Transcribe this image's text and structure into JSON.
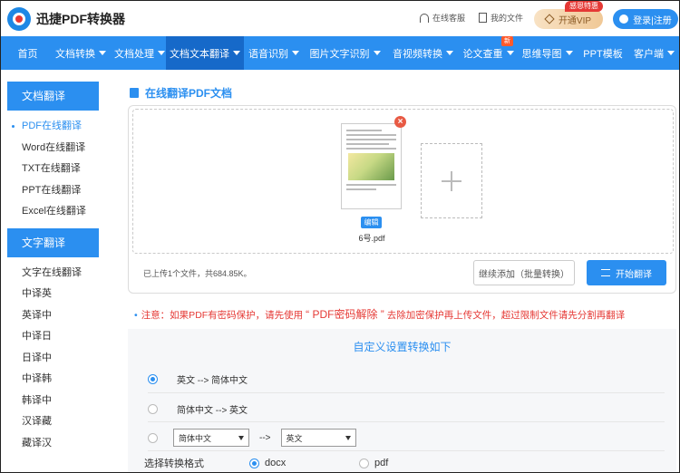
{
  "header": {
    "logo_text": "迅捷PDF转换器",
    "support_label": "在线客服",
    "my_files_label": "我的文件",
    "vip_label": "开通VIP",
    "vip_badge": "感恩特惠",
    "login_label": "登录|注册"
  },
  "nav": [
    {
      "label": "首页",
      "dropdown": false
    },
    {
      "label": "文档转换",
      "dropdown": true
    },
    {
      "label": "文档处理",
      "dropdown": true
    },
    {
      "label": "文档文本翻译",
      "dropdown": true,
      "active": true
    },
    {
      "label": "语音识别",
      "dropdown": true
    },
    {
      "label": "图片文字识别",
      "dropdown": true
    },
    {
      "label": "音视频转换",
      "dropdown": true
    },
    {
      "label": "论文查重",
      "dropdown": true,
      "badge": "新"
    },
    {
      "label": "思维导图",
      "dropdown": true
    },
    {
      "label": "PPT模板",
      "dropdown": false
    },
    {
      "label": "客户端",
      "dropdown": true
    }
  ],
  "sidebar": {
    "doc_heading": "文档翻译",
    "doc_items": [
      "PDF在线翻译",
      "Word在线翻译",
      "TXT在线翻译",
      "PPT在线翻译",
      "Excel在线翻译"
    ],
    "text_heading": "文字翻译",
    "text_items": [
      "文字在线翻译",
      "中译英",
      "英译中",
      "中译日",
      "日译中",
      "中译韩",
      "韩译中",
      "汉译藏",
      "藏译汉"
    ]
  },
  "main": {
    "title": "在线翻译PDF文档",
    "edit_label": "编辑",
    "file_name": "6号.pdf",
    "upload_info": "已上传1个文件，共684.85K。",
    "continue_button": "继续添加（批量转换）",
    "start_button": "开始翻译",
    "notice_prefix": "注意：如果PDF有密码保护，请先使用",
    "notice_link": "“ PDF密码解除 ”",
    "notice_suffix": "去除加密保护再上传文件，超过限制文件请先分割再翻译"
  },
  "settings": {
    "title": "自定义设置转换如下",
    "option1": "英文 --> 简体中文",
    "option2": "简体中文 --> 英文",
    "from_select": "简体中文",
    "arrow": "-->",
    "to_select": "英文",
    "format_label": "选择转换格式",
    "format_docx": "docx",
    "format_pdf": "pdf"
  },
  "colors": {
    "accent": "#2b8ff0",
    "nav_active": "#1669c9",
    "warning": "#e53935"
  }
}
